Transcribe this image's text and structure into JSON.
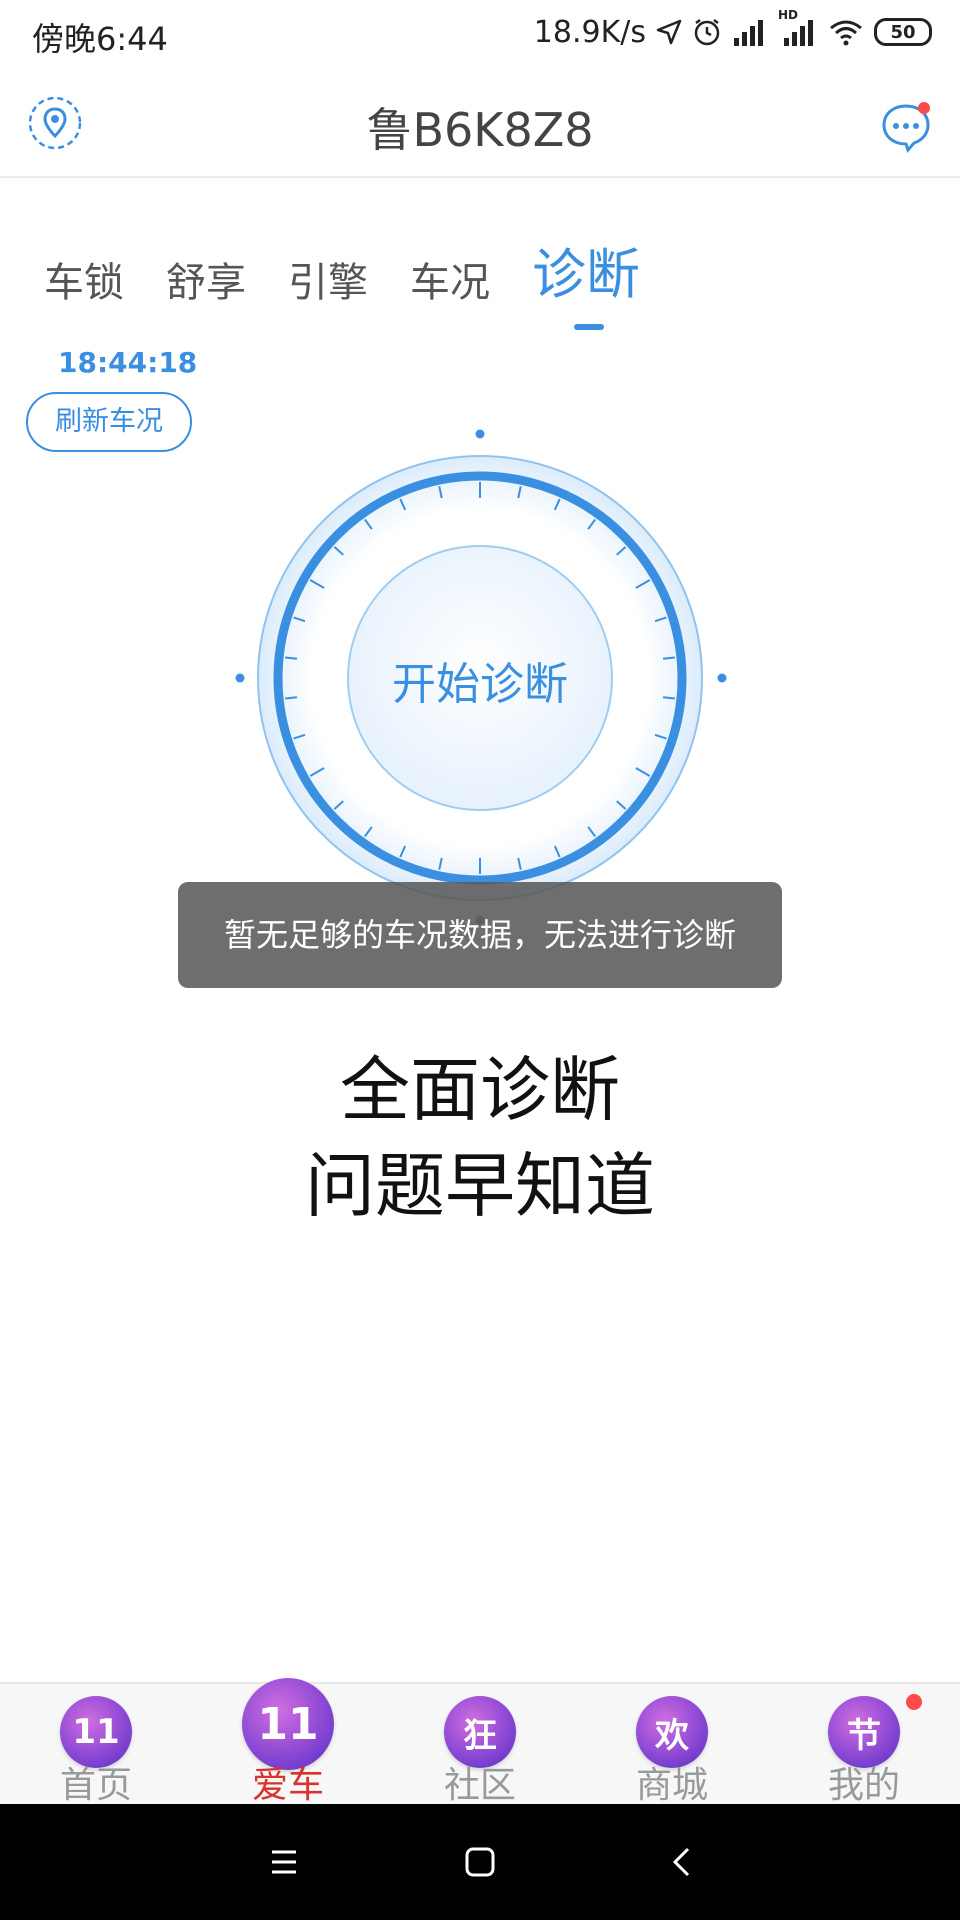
{
  "status_bar": {
    "time": "傍晚6:44",
    "net_speed": "18.9K/s",
    "battery": "50",
    "hd_label": "HD"
  },
  "header": {
    "plate": "鲁B6K8Z8"
  },
  "tabs": [
    {
      "label": "车锁"
    },
    {
      "label": "舒享"
    },
    {
      "label": "引擎"
    },
    {
      "label": "车况"
    },
    {
      "label": "诊断"
    }
  ],
  "refresh": {
    "time": "18:44:18",
    "button_label": "刷新车况"
  },
  "dial": {
    "label": "开始诊断"
  },
  "toast": {
    "message": "暂无足够的车况数据，无法进行诊断"
  },
  "slogan": {
    "line1": "全面诊断",
    "line2": "问题早知道"
  },
  "bottom_nav": [
    {
      "badge": "11",
      "label": "首页"
    },
    {
      "badge": "11",
      "label": "爱车"
    },
    {
      "badge": "狂",
      "label": "社区"
    },
    {
      "badge": "欢",
      "label": "商城"
    },
    {
      "badge": "节",
      "label": "我的"
    }
  ],
  "colors": {
    "accent": "#3b8fe0",
    "active_nav": "#d8332c",
    "notification": "#ff4a4a"
  }
}
